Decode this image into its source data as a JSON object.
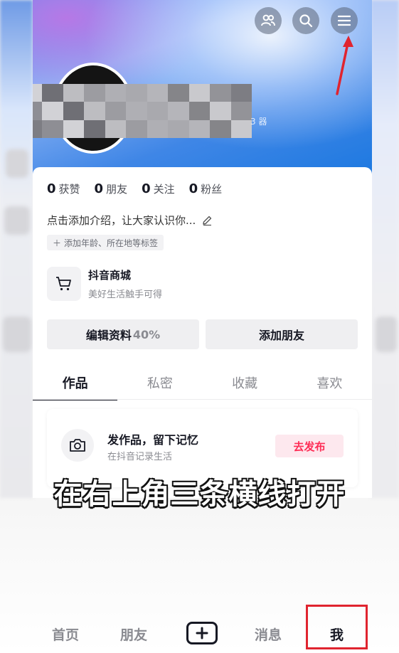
{
  "header": {
    "icons": [
      "friends-icon",
      "search-icon",
      "menu-icon"
    ]
  },
  "profile": {
    "id_partial": "3 器"
  },
  "stats": [
    {
      "num": "0",
      "label": "获赞"
    },
    {
      "num": "0",
      "label": "朋友"
    },
    {
      "num": "0",
      "label": "关注"
    },
    {
      "num": "0",
      "label": "粉丝"
    }
  ],
  "bio": {
    "text": "点击添加介绍，让大家认识你...",
    "tag": "添加年龄、所在地等标签"
  },
  "shop": {
    "title": "抖音商城",
    "subtitle": "美好生活触手可得"
  },
  "actions": {
    "edit_label": "编辑资料",
    "edit_progress": "40%",
    "add_friend_label": "添加朋友"
  },
  "tabs": [
    "作品",
    "私密",
    "收藏",
    "喜欢"
  ],
  "publish": {
    "title": "发作品，留下记忆",
    "subtitle": "在抖音记录生活",
    "button": "去发布"
  },
  "caption": "在右上角三条横线打开",
  "bottom_nav": {
    "home": "首页",
    "friends": "朋友",
    "messages": "消息",
    "me": "我"
  },
  "colors": {
    "accent": "#fe2c55",
    "annotation": "#e0242f"
  }
}
